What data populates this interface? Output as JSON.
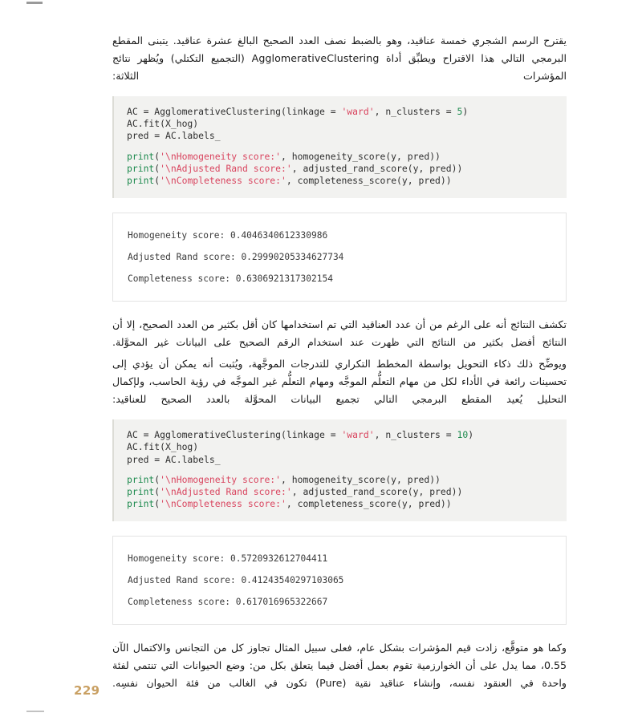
{
  "page": {
    "number": "229",
    "number_color": "#c9a063",
    "background_color": "#ffffff"
  },
  "paragraphs": {
    "intro": [
      "يقترح الرسم الشجري خمسة عناقيد، وهو بالضبط نصف العدد الصحيح البالغ عشرة عناقيد. يتبنى المقطع البرمجي التالي هذا الاقتراح ويطبِّق أداة AgglomerativeClustering (التجميع التكتلي) ويُظهر نتائج المؤشرات الثلاثة:"
    ],
    "middle": [
      "تكشف النتائج أنه على الرغم من أن عدد العناقيد التي تم استخدامها كان أقل بكثير من العدد الصحيح، إلا أن النتائج أفضل بكثير من النتائج التي ظهرت عند استخدام الرقم الصحيح على البيانات غير المحوَّلة.",
      "ويوضِّح ذلك ذكاء التحويل بواسطة المخطط التكراري للتدرجات الموجَّهة، ويُثبت أنه يمكن أن يؤدي إلى تحسينات رائعة في الأداء لكل من مهام التعلُّم الموجَّه ومهام التعلُّم غير الموجَّه في رؤية الحاسب، ولإكمال التحليل يُعيد المقطع البرمجي التالي تجميع البيانات المحوَّلة بالعدد الصحيح للعناقيد:"
    ],
    "conclusion": [
      "وكما هو متوقَّع، زادت قيم المؤشرات بشكل عام، فعلى سبيل المثال تجاوز كل من التجانس والاكتمال الآن 0.55، مما يدل على أن الخوارزمية تقوم بعمل أفضل فيما يتعلق بكل من: وضع الحيوانات التي تنتمي لفئة واحدة في العنقود نفسه، وإنشاء عناقيد نقية (Pure) تكون في الغالب من فئة الحيوان نفسِه."
    ]
  },
  "code_blocks": [
    {
      "name": "agglomerative-clustering-5",
      "background": "#f2f2f0",
      "lines": [
        [
          {
            "t": "AC = AgglomerativeClustering(linkage = ",
            "c": "plain"
          },
          {
            "t": "'ward'",
            "c": "str"
          },
          {
            "t": ", n_clusters = ",
            "c": "plain"
          },
          {
            "t": "5",
            "c": "num"
          },
          {
            "t": ")",
            "c": "plain"
          }
        ],
        [
          {
            "t": "AC.fit(X_hog)",
            "c": "plain"
          }
        ],
        [
          {
            "t": "pred = AC.labels_",
            "c": "plain"
          }
        ],
        [],
        [
          {
            "t": "print",
            "c": "fn"
          },
          {
            "t": "(",
            "c": "plain"
          },
          {
            "t": "'\\nHomogeneity score:'",
            "c": "str"
          },
          {
            "t": ", homogeneity_score(y, pred))",
            "c": "plain"
          }
        ],
        [
          {
            "t": "print",
            "c": "fn"
          },
          {
            "t": "(",
            "c": "plain"
          },
          {
            "t": "'\\nAdjusted Rand score:'",
            "c": "str"
          },
          {
            "t": ", adjusted_rand_score(y, pred))",
            "c": "plain"
          }
        ],
        [
          {
            "t": "print",
            "c": "fn"
          },
          {
            "t": "(",
            "c": "plain"
          },
          {
            "t": "'\\nCompleteness score:'",
            "c": "str"
          },
          {
            "t": ", completeness_score(y, pred))",
            "c": "plain"
          }
        ]
      ]
    },
    {
      "name": "agglomerative-clustering-10",
      "background": "#f2f2f0",
      "lines": [
        [
          {
            "t": "AC = AgglomerativeClustering(linkage = ",
            "c": "plain"
          },
          {
            "t": "'ward'",
            "c": "str"
          },
          {
            "t": ", n_clusters = ",
            "c": "plain"
          },
          {
            "t": "10",
            "c": "num"
          },
          {
            "t": ")",
            "c": "plain"
          }
        ],
        [
          {
            "t": "AC.fit(X_hog)",
            "c": "plain"
          }
        ],
        [
          {
            "t": "pred = AC.labels_",
            "c": "plain"
          }
        ],
        [],
        [
          {
            "t": "print",
            "c": "fn"
          },
          {
            "t": "(",
            "c": "plain"
          },
          {
            "t": "'\\nHomogeneity score:'",
            "c": "str"
          },
          {
            "t": ", homogeneity_score(y, pred))",
            "c": "plain"
          }
        ],
        [
          {
            "t": "print",
            "c": "fn"
          },
          {
            "t": "(",
            "c": "plain"
          },
          {
            "t": "'\\nAdjusted Rand score:'",
            "c": "str"
          },
          {
            "t": ", adjusted_rand_score(y, pred))",
            "c": "plain"
          }
        ],
        [
          {
            "t": "print",
            "c": "fn"
          },
          {
            "t": "(",
            "c": "plain"
          },
          {
            "t": "'\\nCompleteness score:'",
            "c": "str"
          },
          {
            "t": ", completeness_score(y, pred))",
            "c": "plain"
          }
        ]
      ]
    }
  ],
  "outputs": [
    {
      "name": "scores-output-5-clusters",
      "lines": [
        "Homogeneity score: 0.4046340612330986",
        "Adjusted Rand score: 0.29990205334627734",
        "Completeness score: 0.6306921317302154"
      ]
    },
    {
      "name": "scores-output-10-clusters",
      "lines": [
        "Homogeneity score: 0.5720932612704411",
        "Adjusted Rand score: 0.41243540297103065",
        "Completeness score: 0.617016965322667"
      ]
    }
  ],
  "colors": {
    "code_bg": "#f2f2f0",
    "string_token": "#d9455f",
    "number_token": "#1d8a4e",
    "function_token": "#1d8a4e",
    "output_border": "#e3e3e3",
    "body_text": "#1a1a1a"
  }
}
